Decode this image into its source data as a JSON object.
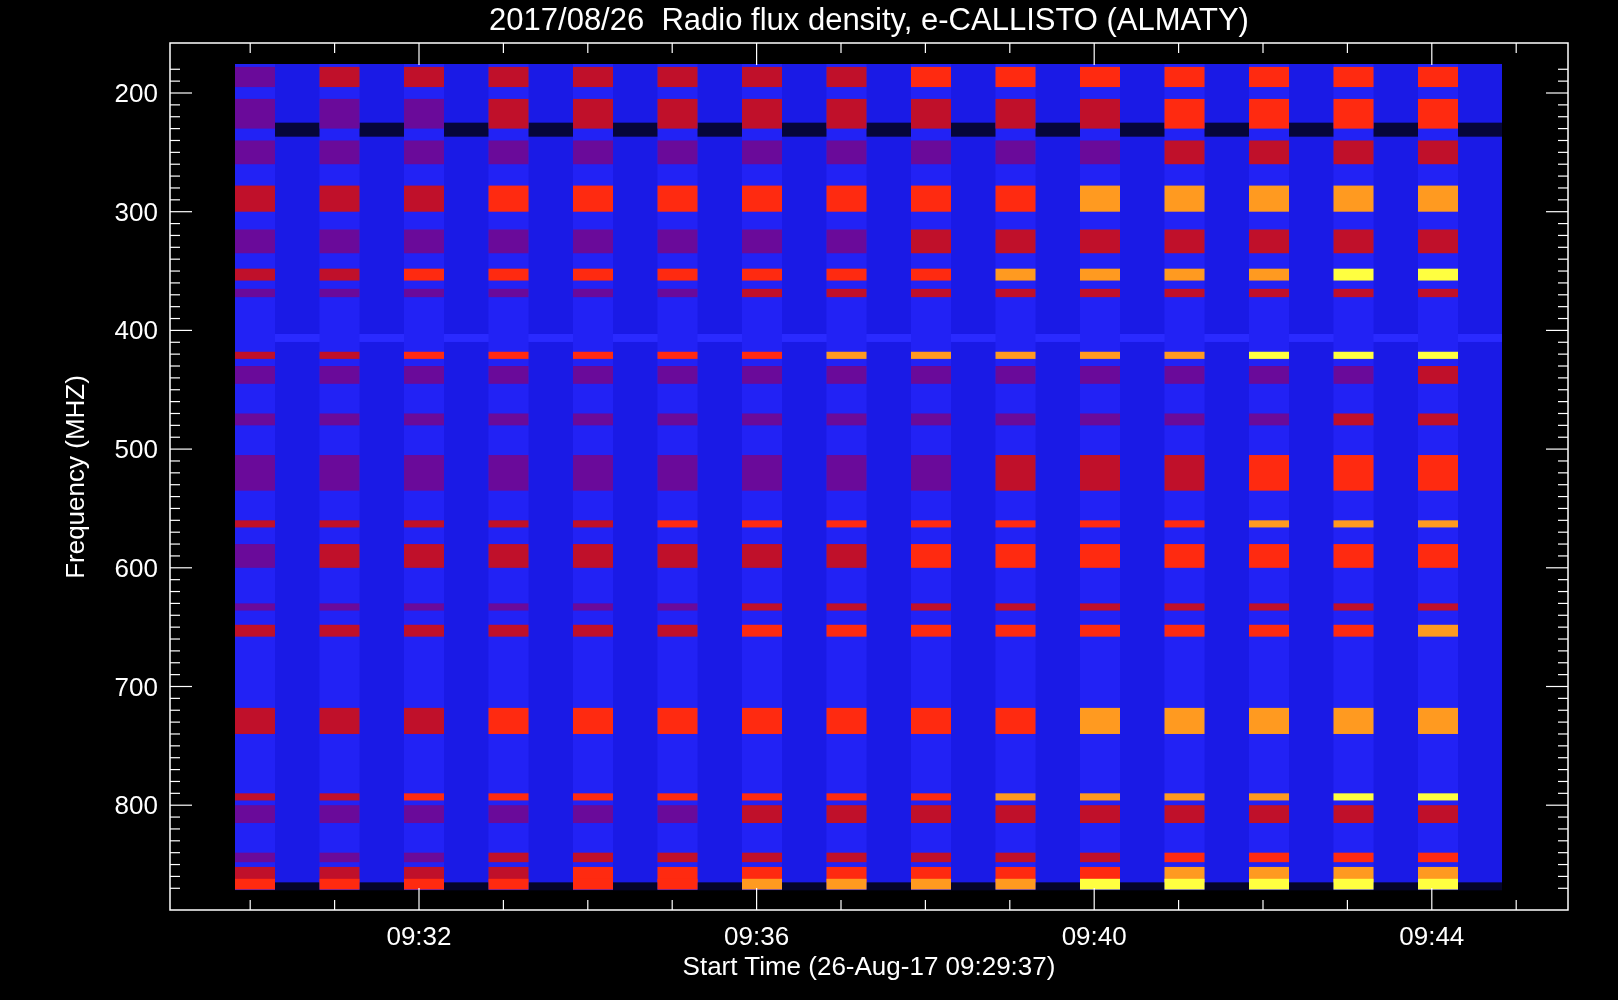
{
  "title": "2017/08/26  Radio flux density, e-CALLISTO (ALMATY)",
  "ylabel": "Frequency (MHZ)",
  "yticks": [
    "200",
    "300",
    "400",
    "500",
    "600",
    "700",
    "800"
  ],
  "xticks": [
    "09:32",
    "09:36",
    "09:40",
    "09:44"
  ],
  "xlabel": "Start Time (26-Aug-17 09:29:37)"
}
